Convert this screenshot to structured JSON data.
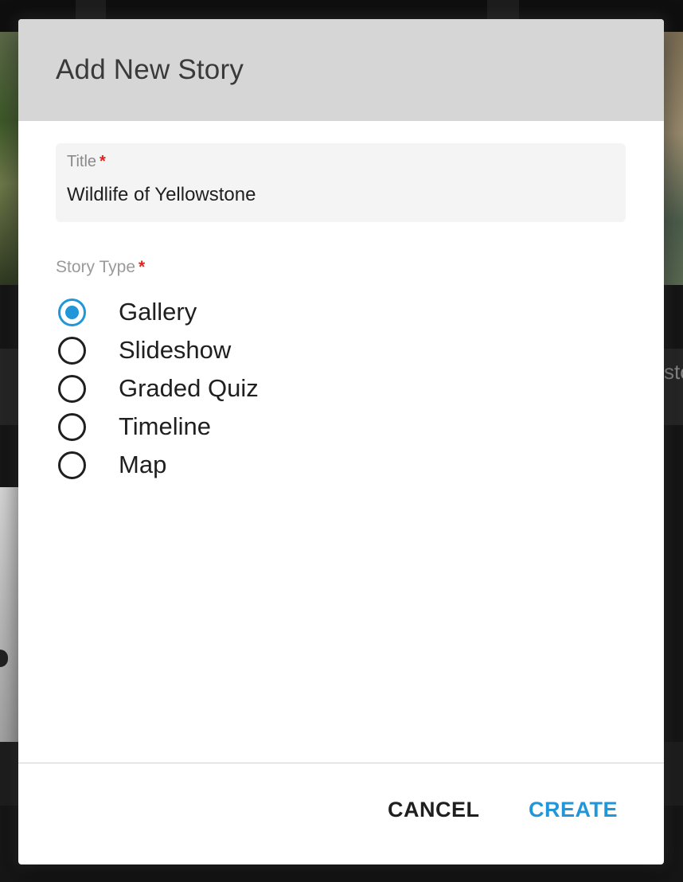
{
  "background": {
    "peek_text": "sto"
  },
  "dialog": {
    "title": "Add New Story",
    "title_field": {
      "label": "Title",
      "required_mark": "*",
      "value": "Wildlife of Yellowstone"
    },
    "story_type": {
      "label": "Story Type",
      "required_mark": "*",
      "selected": "Gallery",
      "options": [
        {
          "label": "Gallery",
          "checked": true
        },
        {
          "label": "Slideshow",
          "checked": false
        },
        {
          "label": "Graded Quiz",
          "checked": false
        },
        {
          "label": "Timeline",
          "checked": false
        },
        {
          "label": "Map",
          "checked": false
        }
      ]
    },
    "actions": {
      "cancel_label": "CANCEL",
      "create_label": "CREATE"
    }
  },
  "colors": {
    "accent": "#2196d8",
    "required": "#e0231e",
    "header_bg": "#d6d6d6"
  }
}
